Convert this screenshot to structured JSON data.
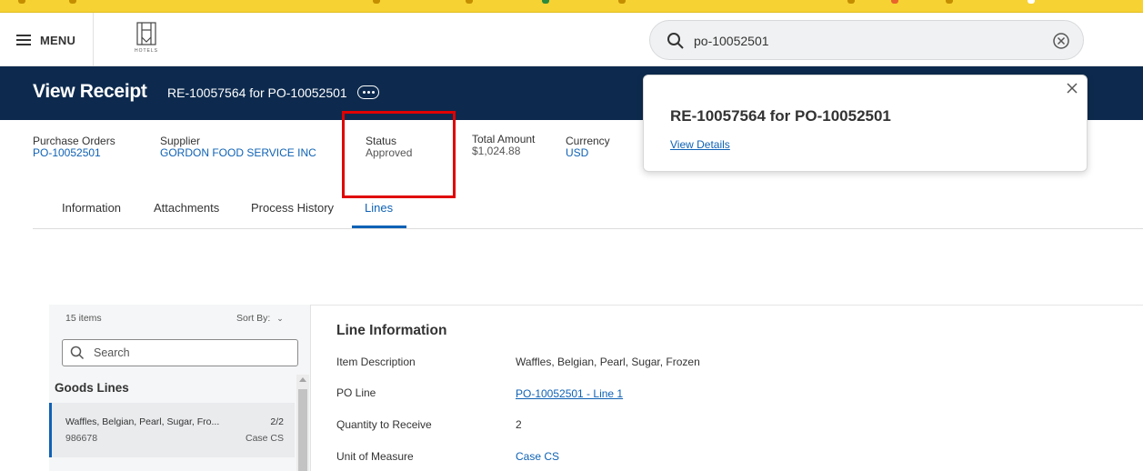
{
  "header": {
    "menu_label": "MENU",
    "logo_text": "HOTELS",
    "search_value": "po-10052501"
  },
  "page": {
    "title": "View Receipt",
    "subtitle": "RE-10057564 for PO-10052501"
  },
  "summary": {
    "purchase_orders_label": "Purchase Orders",
    "purchase_orders_value": "PO-10052501",
    "supplier_label": "Supplier",
    "supplier_value": "GORDON FOOD SERVICE INC",
    "status_label": "Status",
    "status_value": "Approved",
    "total_label": "Total Amount",
    "total_value": "$1,024.88",
    "currency_label": "Currency",
    "currency_value": "USD"
  },
  "tabs": [
    {
      "label": "Information"
    },
    {
      "label": "Attachments"
    },
    {
      "label": "Process History"
    },
    {
      "label": "Lines"
    }
  ],
  "active_tab": "Lines",
  "popover": {
    "title": "RE-10057564 for PO-10052501",
    "link": "View Details"
  },
  "lines_panel": {
    "count": "15 items",
    "sort_label": "Sort By:",
    "search_placeholder": "Search",
    "section": "Goods Lines",
    "items": [
      {
        "name": "Waffles, Belgian, Pearl, Sugar, Fro...",
        "count": "2/2",
        "id": "986678",
        "unit": "Case CS"
      }
    ]
  },
  "line_info": {
    "title": "Line Information",
    "rows": [
      {
        "label": "Item Description",
        "value": "Waffles, Belgian, Pearl, Sugar, Frozen"
      },
      {
        "label": "PO Line",
        "value": "PO-10052501 - Line 1"
      },
      {
        "label": "Quantity to Receive",
        "value": "2"
      },
      {
        "label": "Unit of Measure",
        "value": "Case CS"
      }
    ]
  },
  "colors": {
    "title_band": "#0d2a4e",
    "link": "#0f62b5",
    "highlight": "#e00000",
    "top_strip": "#f6d233"
  }
}
